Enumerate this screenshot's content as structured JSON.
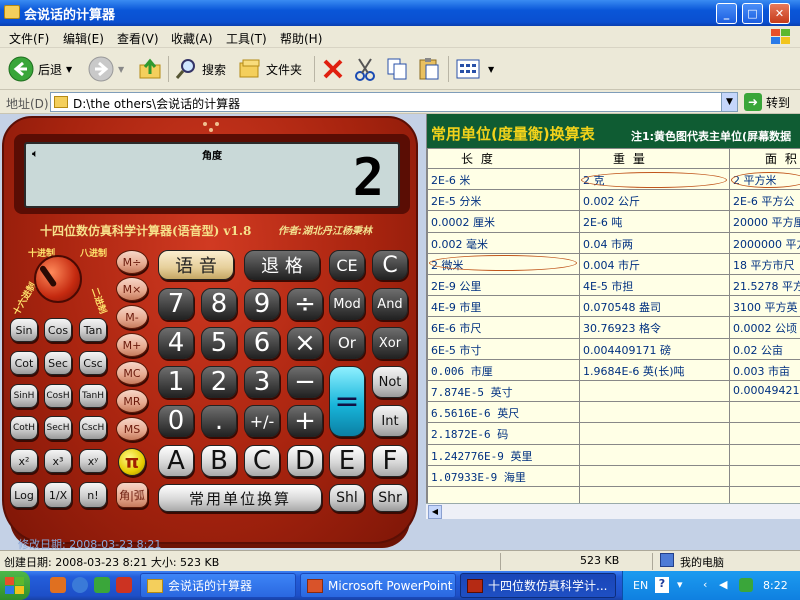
{
  "window": {
    "title": "会说话的计算器",
    "controls": [
      "_",
      "□",
      "✕"
    ]
  },
  "menu": [
    "文件(F)",
    "编辑(E)",
    "查看(V)",
    "收藏(A)",
    "工具(T)",
    "帮助(H)"
  ],
  "toolbar": {
    "back": "后退",
    "search": "搜索",
    "folders": "文件夹"
  },
  "address": {
    "label": "地址(D)",
    "path": "D:\\the others\\会说话的计算器",
    "go": "转到"
  },
  "calculator": {
    "display_mode": "角度",
    "display_value": "2",
    "model": "十四位数仿真科学计算器(语音型) v1.8",
    "author": "作者:湖北丹江杨秉林",
    "dial": [
      "十进制",
      "八进制",
      "十六进制",
      "二进制"
    ],
    "sci_keys": [
      [
        "Sin",
        "Cos",
        "Tan"
      ],
      [
        "Cot",
        "Sec",
        "Csc"
      ],
      [
        "SinH",
        "CosH",
        "TanH"
      ],
      [
        "CotH",
        "SecH",
        "CscH"
      ],
      [
        "x²",
        "x³",
        "xʸ"
      ],
      [
        "Log",
        "1/X",
        "n!"
      ]
    ],
    "mem_keys": [
      "M÷",
      "M×",
      "M-",
      "M+",
      "MC",
      "MR",
      "MS"
    ],
    "pi": "π",
    "angle_key": "角|弧",
    "voice": "语 音",
    "backspace": "退 格",
    "ce": "CE",
    "c": "C",
    "digits_row1": [
      "7",
      "8",
      "9",
      "÷"
    ],
    "digits_row2": [
      "4",
      "5",
      "6",
      "×"
    ],
    "digits_row3": [
      "1",
      "2",
      "3",
      "−"
    ],
    "digits_row4": [
      "0",
      ".",
      "+/-",
      "+"
    ],
    "equals": "=",
    "right_keys": [
      "Mod",
      "And",
      "Or",
      "Xor",
      "Not",
      "Int"
    ],
    "hex_keys": [
      "A",
      "B",
      "C",
      "D",
      "E",
      "F"
    ],
    "unit_button": "常用单位换算",
    "shift_keys": [
      "Shl",
      "Shr"
    ]
  },
  "unit_table": {
    "title": "常用单位(度量衡)换算表",
    "note": "注1:黄色图代表主单位(屏幕数据",
    "headers": [
      "长 度",
      "重 量",
      "面 积"
    ],
    "rows": [
      [
        "2E-6 米",
        "2 克",
        "2 平方米"
      ],
      [
        "2E-5 分米",
        "0.002 公斤",
        "2E-6 平方公"
      ],
      [
        "0.0002 厘米",
        "2E-6 吨",
        "20000 平方厘"
      ],
      [
        "0.002 毫米",
        "0.04 市两",
        "2000000 平方"
      ],
      [
        "2 微米",
        "0.004 市斤",
        "18 平方市尺"
      ],
      [
        "2E-9 公里",
        "4E-5 市担",
        "21.5278 平方"
      ],
      [
        "4E-9 市里",
        "0.070548 盎司",
        "3100 平方英"
      ],
      [
        "6E-6 市尺",
        "30.76923 格令",
        "0.0002 公顷"
      ],
      [
        "6E-5 市寸",
        "0.004409171 磅",
        "0.02 公亩"
      ],
      [
        "0.006 市厘",
        "1.9684E-6 英(长)吨",
        "0.003 市亩"
      ],
      [
        "7.874E-5 英寸",
        "",
        "0.00049421"
      ],
      [
        "6.5616E-6 英尺",
        "",
        ""
      ],
      [
        "2.1872E-6 码",
        "",
        ""
      ],
      [
        "1.242776E-9 英里",
        "",
        ""
      ],
      [
        "1.07933E-9 海里",
        "",
        ""
      ]
    ]
  },
  "statusbar": {
    "ghost": "修改日期: 2008-03-23 8:21",
    "info": "创建日期: 2008-03-23 8:21 大小: 523 KB",
    "size": "523 KB",
    "location": "我的电脑"
  },
  "taskbar": {
    "tasks": [
      "会说话的计算器",
      "Microsoft PowerPoint",
      "十四位数仿真科学计..."
    ],
    "lang": "EN",
    "clock": "8:22"
  }
}
